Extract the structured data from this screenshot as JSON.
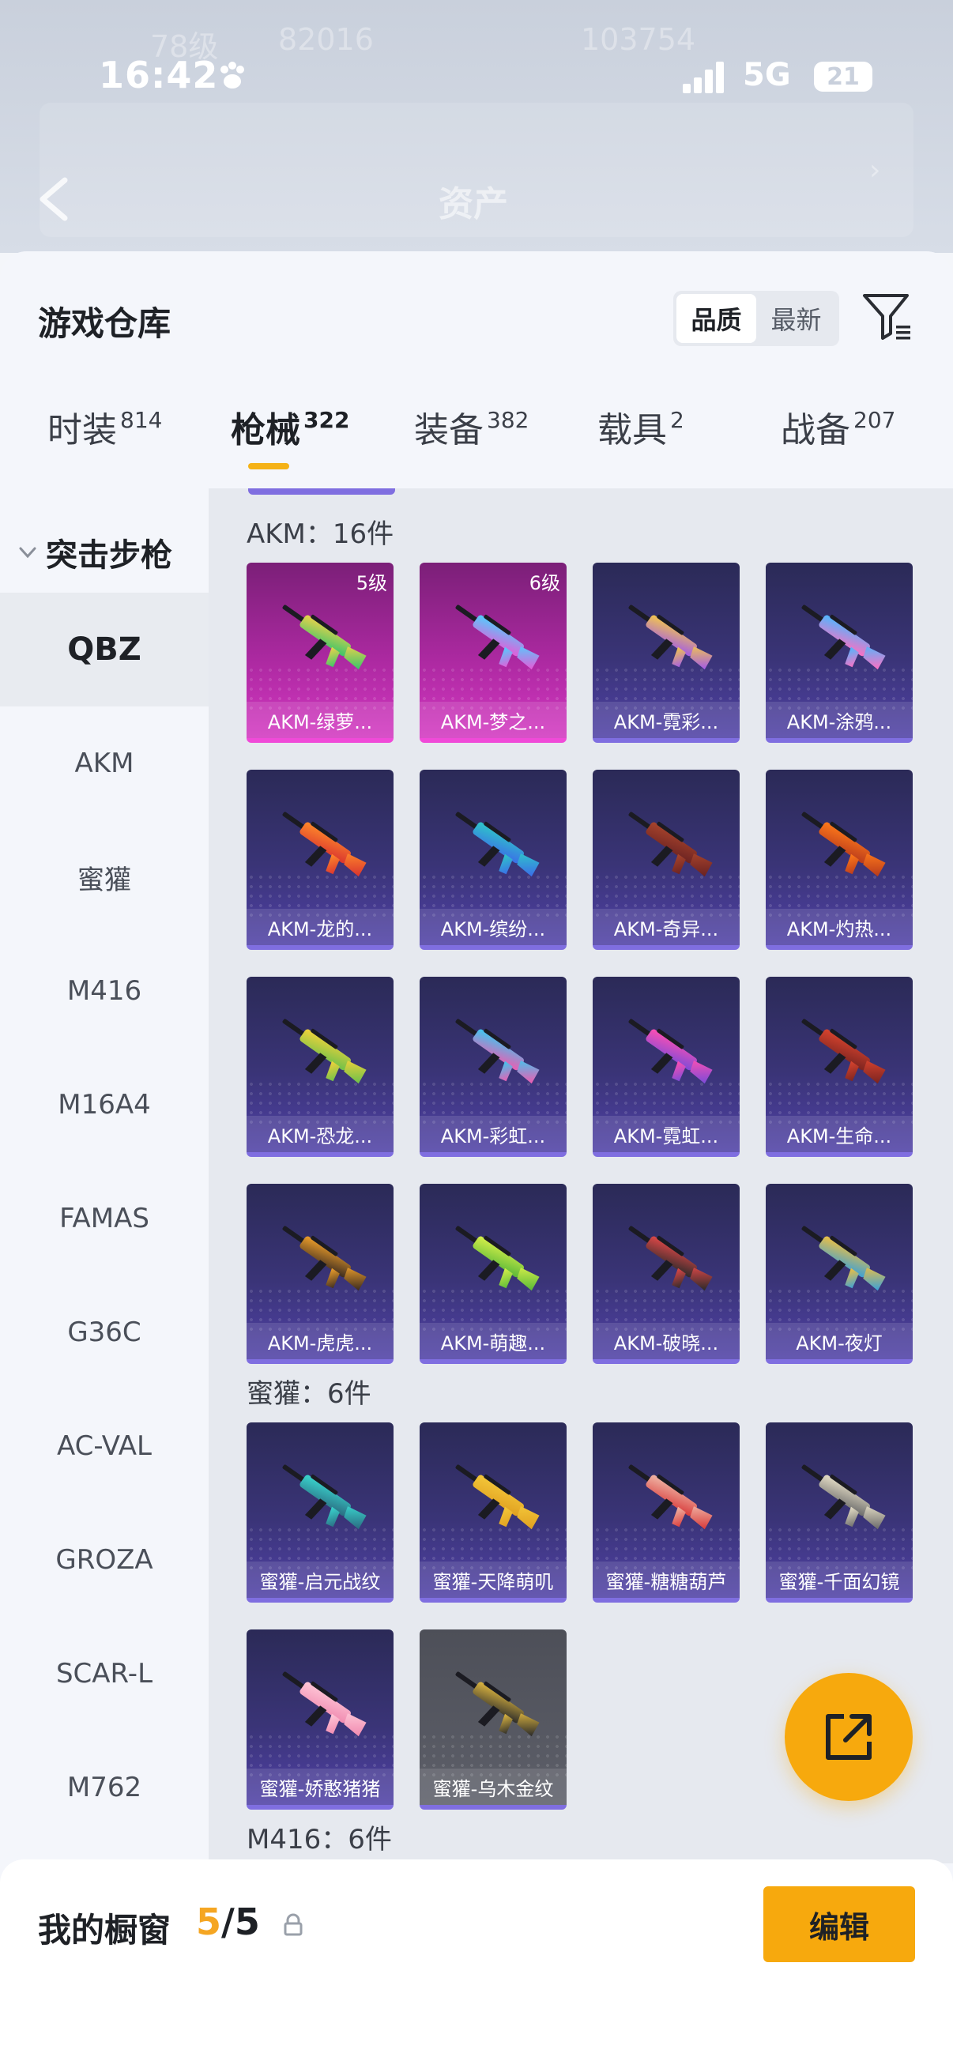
{
  "status": {
    "time": "16:42",
    "network": "5G",
    "battery": "21"
  },
  "header": {
    "title": "资产",
    "ghost_rows": [
      "78级",
      "82016",
      "103754"
    ]
  },
  "sheet": {
    "title": "游戏仓库",
    "sort_options": [
      "品质",
      "最新"
    ],
    "sort_selected": "品质"
  },
  "tabs": [
    {
      "label": "时装",
      "count": "814"
    },
    {
      "label": "枪械",
      "count": "322",
      "active": true
    },
    {
      "label": "装备",
      "count": "382"
    },
    {
      "label": "载具",
      "count": "2"
    },
    {
      "label": "战备",
      "count": "207"
    }
  ],
  "sidebar": {
    "category": "突击步枪",
    "items": [
      "QBZ",
      "AKM",
      "蜜獾",
      "M416",
      "M16A4",
      "FAMAS",
      "G36C",
      "AC-VAL",
      "GROZA",
      "SCAR-L",
      "M762"
    ],
    "selected": "QBZ"
  },
  "groups": [
    {
      "header": "AKM：16件",
      "items": [
        {
          "name": "AKM-绿萝...",
          "level": "5级",
          "rarity": "pink",
          "colors": [
            "#f0d24a",
            "#38c46a"
          ]
        },
        {
          "name": "AKM-梦之...",
          "level": "6级",
          "rarity": "pink",
          "colors": [
            "#4fd0ff",
            "#e65ad8"
          ]
        },
        {
          "name": "AKM-霓彩...",
          "rarity": "purple",
          "colors": [
            "#f4c84a",
            "#a25ae8"
          ]
        },
        {
          "name": "AKM-涂鸦...",
          "rarity": "purple",
          "colors": [
            "#4cb8ff",
            "#ff6ec2"
          ]
        },
        {
          "name": "AKM-龙的...",
          "rarity": "purple",
          "colors": [
            "#ff8a2a",
            "#d9332f"
          ]
        },
        {
          "name": "AKM-缤纷...",
          "rarity": "purple",
          "colors": [
            "#2ec8c8",
            "#3b6de8"
          ]
        },
        {
          "name": "AKM-奇异...",
          "rarity": "purple",
          "colors": [
            "#a8442c",
            "#6a2222"
          ]
        },
        {
          "name": "AKM-灼热...",
          "rarity": "purple",
          "colors": [
            "#ff7a1a",
            "#b83a1c"
          ]
        },
        {
          "name": "AKM-恐龙...",
          "rarity": "purple",
          "colors": [
            "#f4d23a",
            "#6cc04a"
          ]
        },
        {
          "name": "AKM-彩虹...",
          "rarity": "purple",
          "colors": [
            "#3cc8f0",
            "#f05ab0"
          ]
        },
        {
          "name": "AKM-霓虹...",
          "rarity": "purple",
          "colors": [
            "#ff4fb2",
            "#7b4bd8"
          ]
        },
        {
          "name": "AKM-生命...",
          "rarity": "purple",
          "colors": [
            "#d9442e",
            "#7a2420"
          ]
        },
        {
          "name": "AKM-虎虎...",
          "rarity": "purple",
          "colors": [
            "#f0a02a",
            "#3a2a20"
          ]
        },
        {
          "name": "AKM-萌趣...",
          "rarity": "purple",
          "colors": [
            "#d8f04a",
            "#58b838"
          ]
        },
        {
          "name": "AKM-破晓...",
          "rarity": "purple",
          "colors": [
            "#e04848",
            "#2a2a2a"
          ]
        },
        {
          "name": "AKM-夜灯",
          "rarity": "purple",
          "colors": [
            "#f0c040",
            "#3aa0d8"
          ]
        }
      ]
    },
    {
      "header": "蜜獾：6件",
      "items": [
        {
          "name": "蜜獾-启元战纹",
          "rarity": "purple",
          "colors": [
            "#3ad8d0",
            "#2a6a80"
          ]
        },
        {
          "name": "蜜獾-天降萌叽",
          "rarity": "purple",
          "colors": [
            "#f4c83a",
            "#e0a020"
          ]
        },
        {
          "name": "蜜獾-糖糖葫芦",
          "rarity": "purple",
          "colors": [
            "#f0b8a8",
            "#d83a3a"
          ]
        },
        {
          "name": "蜜獾-千面幻镜",
          "rarity": "purple",
          "colors": [
            "#e8e0c8",
            "#6a6a6a"
          ]
        },
        {
          "name": "蜜獾-娇憨猪猪",
          "rarity": "purple",
          "colors": [
            "#ffc8d8",
            "#f08ab0"
          ]
        },
        {
          "name": "蜜獾-乌木金纹",
          "rarity": "gray",
          "colors": [
            "#e0b840",
            "#2a2a2a"
          ]
        }
      ]
    },
    {
      "header": "M416：6件",
      "items": []
    }
  ],
  "bottom": {
    "title": "我的橱窗",
    "current": "5",
    "total": "/5",
    "edit_label": "编辑"
  },
  "colors": {
    "accent": "#f7a90d",
    "pink_rarity": "#d338c1",
    "purple_rarity": "#5041a6"
  }
}
